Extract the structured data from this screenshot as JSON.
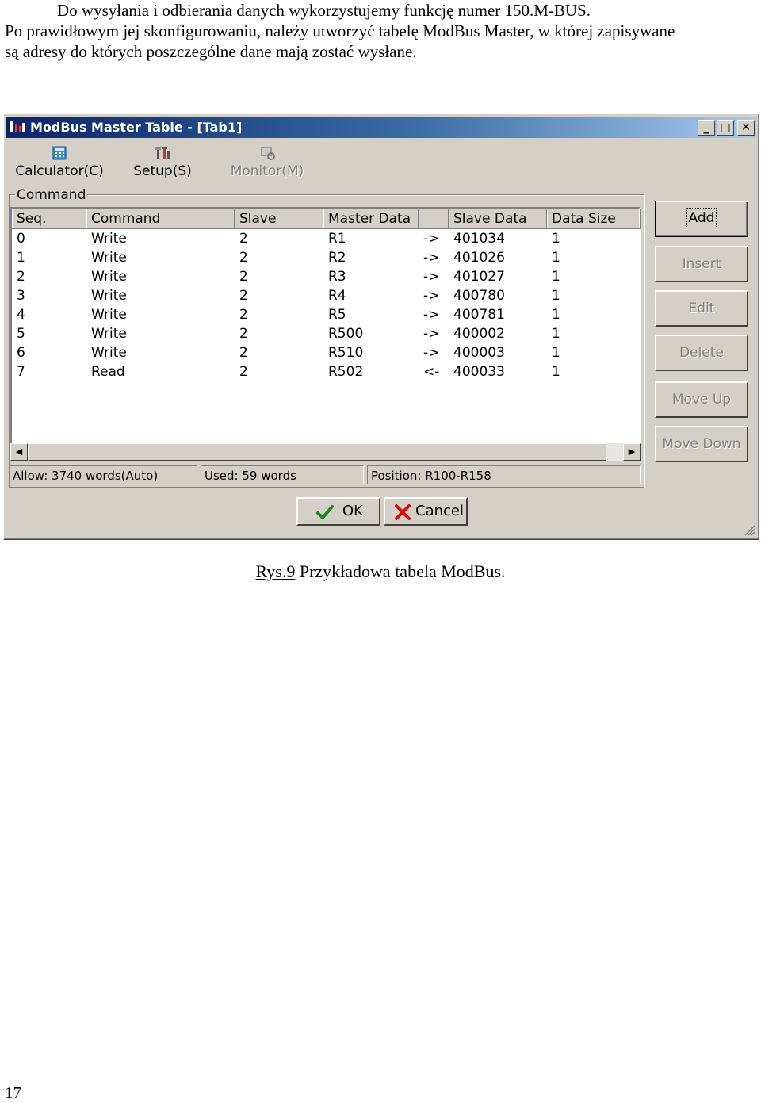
{
  "document": {
    "paragraph_line1": "Do wysyłania i odbierania danych wykorzystujemy funkcję numer 150.M-BUS.",
    "paragraph_line2": "Po prawidłowym jej skonfigurowaniu, należy utworzyć tabelę ModBus Master, w której zapisywane",
    "paragraph_line3": "są adresy do których poszczególne dane mają zostać wysłane.",
    "caption_ref": "Rys.9",
    "caption_text": " Przykładowa tabela ModBus.",
    "page_number": "17"
  },
  "window": {
    "title": "ModBus Master Table - [Tab1]",
    "toolbar": {
      "calculator": "Calculator(C)",
      "setup": "Setup(S)",
      "monitor": "Monitor(M)"
    },
    "group_label": "Command",
    "columns": [
      "Seq.",
      "Command",
      "Slave",
      "Master Data",
      "",
      "Slave Data",
      "Data Size"
    ],
    "rows": [
      [
        "0",
        "Write",
        "2",
        "R1",
        "->",
        "401034",
        "1"
      ],
      [
        "1",
        "Write",
        "2",
        "R2",
        "->",
        "401026",
        "1"
      ],
      [
        "2",
        "Write",
        "2",
        "R3",
        "->",
        "401027",
        "1"
      ],
      [
        "3",
        "Write",
        "2",
        "R4",
        "->",
        "400780",
        "1"
      ],
      [
        "4",
        "Write",
        "2",
        "R5",
        "->",
        "400781",
        "1"
      ],
      [
        "5",
        "Write",
        "2",
        "R500",
        "->",
        "400002",
        "1"
      ],
      [
        "6",
        "Write",
        "2",
        "R510",
        "->",
        "400003",
        "1"
      ],
      [
        "7",
        "Read",
        "2",
        "R502",
        "<-",
        "400033",
        "1"
      ]
    ],
    "status": {
      "allow": "Allow: 3740 words(Auto)",
      "used": "Used: 59 words",
      "position": "Position: R100-R158"
    },
    "side_buttons": {
      "add": "Add",
      "insert": "Insert",
      "edit": "Edit",
      "delete": "Delete",
      "move_up": "Move Up",
      "move_down": "Move Down"
    },
    "ok": "OK",
    "cancel": "Cancel"
  },
  "colors": {
    "title_active": "#0a246a",
    "face": "#d4d0c8",
    "ok_check": "#1a8a1a",
    "cancel_x": "#d01010"
  }
}
